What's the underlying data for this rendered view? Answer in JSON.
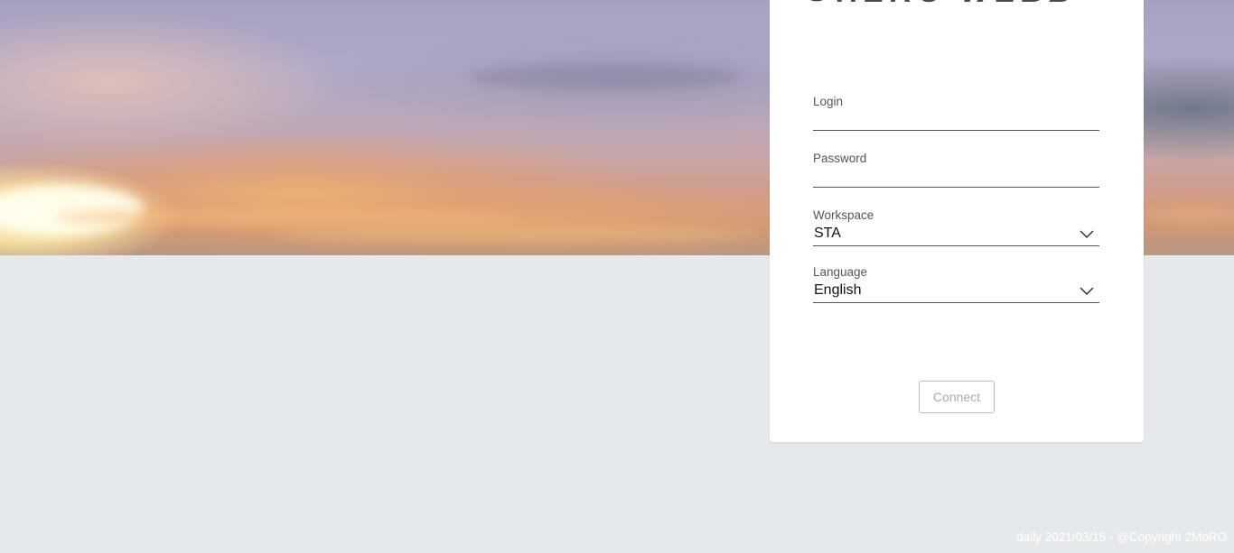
{
  "app": {
    "logo_text": "HERO WEBB"
  },
  "form": {
    "login_label": "Login",
    "login_value": "",
    "password_label": "Password",
    "password_value": "",
    "workspace_label": "Workspace",
    "workspace_value": "STA",
    "language_label": "Language",
    "language_value": "English",
    "connect_label": "Connect"
  },
  "footer": {
    "text": "daily 2021/03/15 - @Copyright 2MoRO"
  },
  "colors": {
    "page_background": "#e6e9ec",
    "card_background": "#ffffff",
    "button_text_disabled": "#aaaaaa"
  },
  "icons": [
    "logo-mark-icon",
    "chevron-down-icon"
  ]
}
